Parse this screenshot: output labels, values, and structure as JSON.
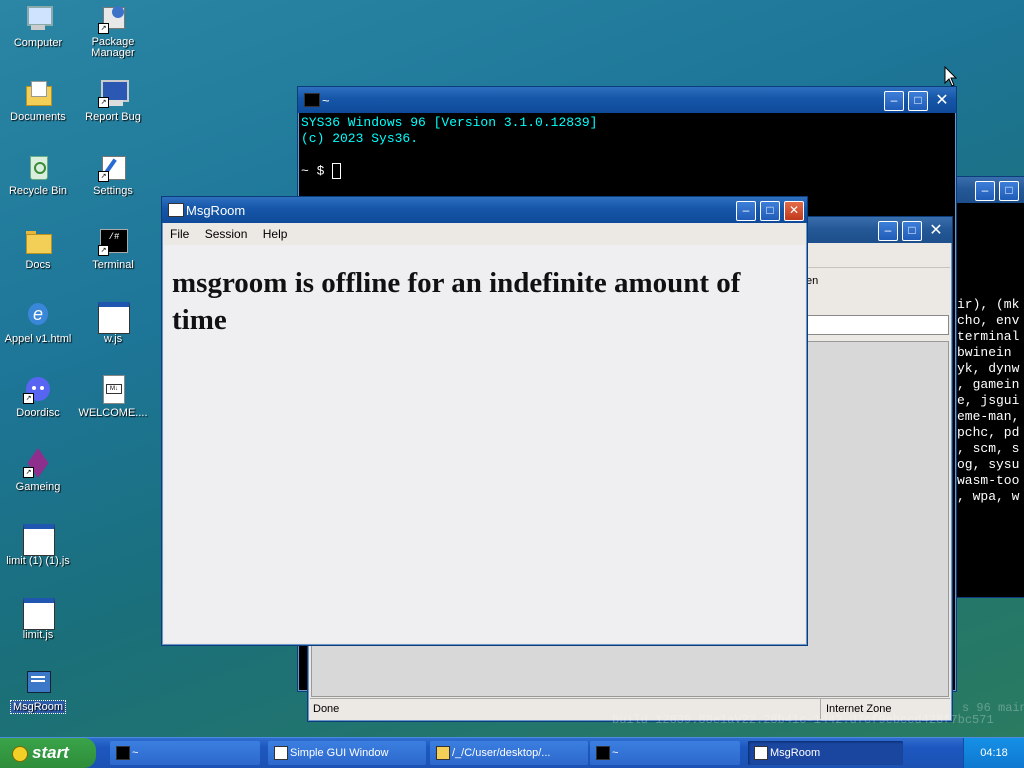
{
  "desktop_icons": [
    {
      "label": "Computer",
      "icon": "computer-icon"
    },
    {
      "label": "Package Manager",
      "icon": "package-manager-icon"
    },
    {
      "label": "Documents",
      "icon": "documents-folder-icon"
    },
    {
      "label": "Report Bug",
      "icon": "report-bug-icon"
    },
    {
      "label": "Recycle Bin",
      "icon": "recycle-bin-icon"
    },
    {
      "label": "Settings",
      "icon": "settings-icon"
    },
    {
      "label": "Docs",
      "icon": "folder-icon"
    },
    {
      "label": "Terminal",
      "icon": "terminal-icon"
    },
    {
      "label": "Appel v1.html",
      "icon": "browser-icon"
    },
    {
      "label": "w.js",
      "icon": "window-file-icon"
    },
    {
      "label": "Doordisc",
      "icon": "discord-icon"
    },
    {
      "label": "WELCOME....",
      "icon": "markdown-file-icon"
    },
    {
      "label": "Gameing",
      "icon": "game-cube-icon"
    },
    {
      "label": "limit (1) (1).js",
      "icon": "window-file-icon"
    },
    {
      "label": "limit.js",
      "icon": "window-file-icon"
    },
    {
      "label": "MsgRoom",
      "icon": "msgroom-icon"
    }
  ],
  "terminal_window": {
    "title": "~",
    "lines": [
      "SYS36 Windows 96 [Version 3.1.0.12839]",
      "(c) 2023 Sys36."
    ],
    "prompt": "~ $"
  },
  "bg_terminal": {
    "lines": [
      "ir), (mk",
      "cho, env",
      "",
      "terminal",
      "",
      "bwinein",
      "yk, dynw",
      ", gamein",
      "e, jsgui",
      "eme-man,",
      "pchc, pd",
      ", scm, s",
      "og, sysu",
      "wasm-too",
      ", wpa, w"
    ]
  },
  "browser_window": {
    "partial_tab": "en",
    "status_left": "Done",
    "status_right": "Internet Zone"
  },
  "msgroom_window": {
    "title": "MsgRoom",
    "menu": [
      "File",
      "Session",
      "Help"
    ],
    "heading": "msgroom is offline for an indefinite amount of time"
  },
  "watermark": {
    "line1": "s 96 main",
    "line2": "build 12839.88e1aV22.28b41c-1442.d7cf9ebccd428f7bc571"
  },
  "taskbar": {
    "start_label": "start",
    "tasks": [
      {
        "label": "~",
        "active": false
      },
      {
        "label": "Simple GUI Window",
        "active": false
      },
      {
        "label": "/_/C/user/desktop/...",
        "active": false
      },
      {
        "label": "~",
        "active": false
      },
      {
        "label": "MsgRoom",
        "active": true
      }
    ],
    "clock": "04:18"
  },
  "colors": {
    "terminal_text": "#00ffff",
    "taskbar": "#1d58c0",
    "start_button": "#3aa44a"
  }
}
